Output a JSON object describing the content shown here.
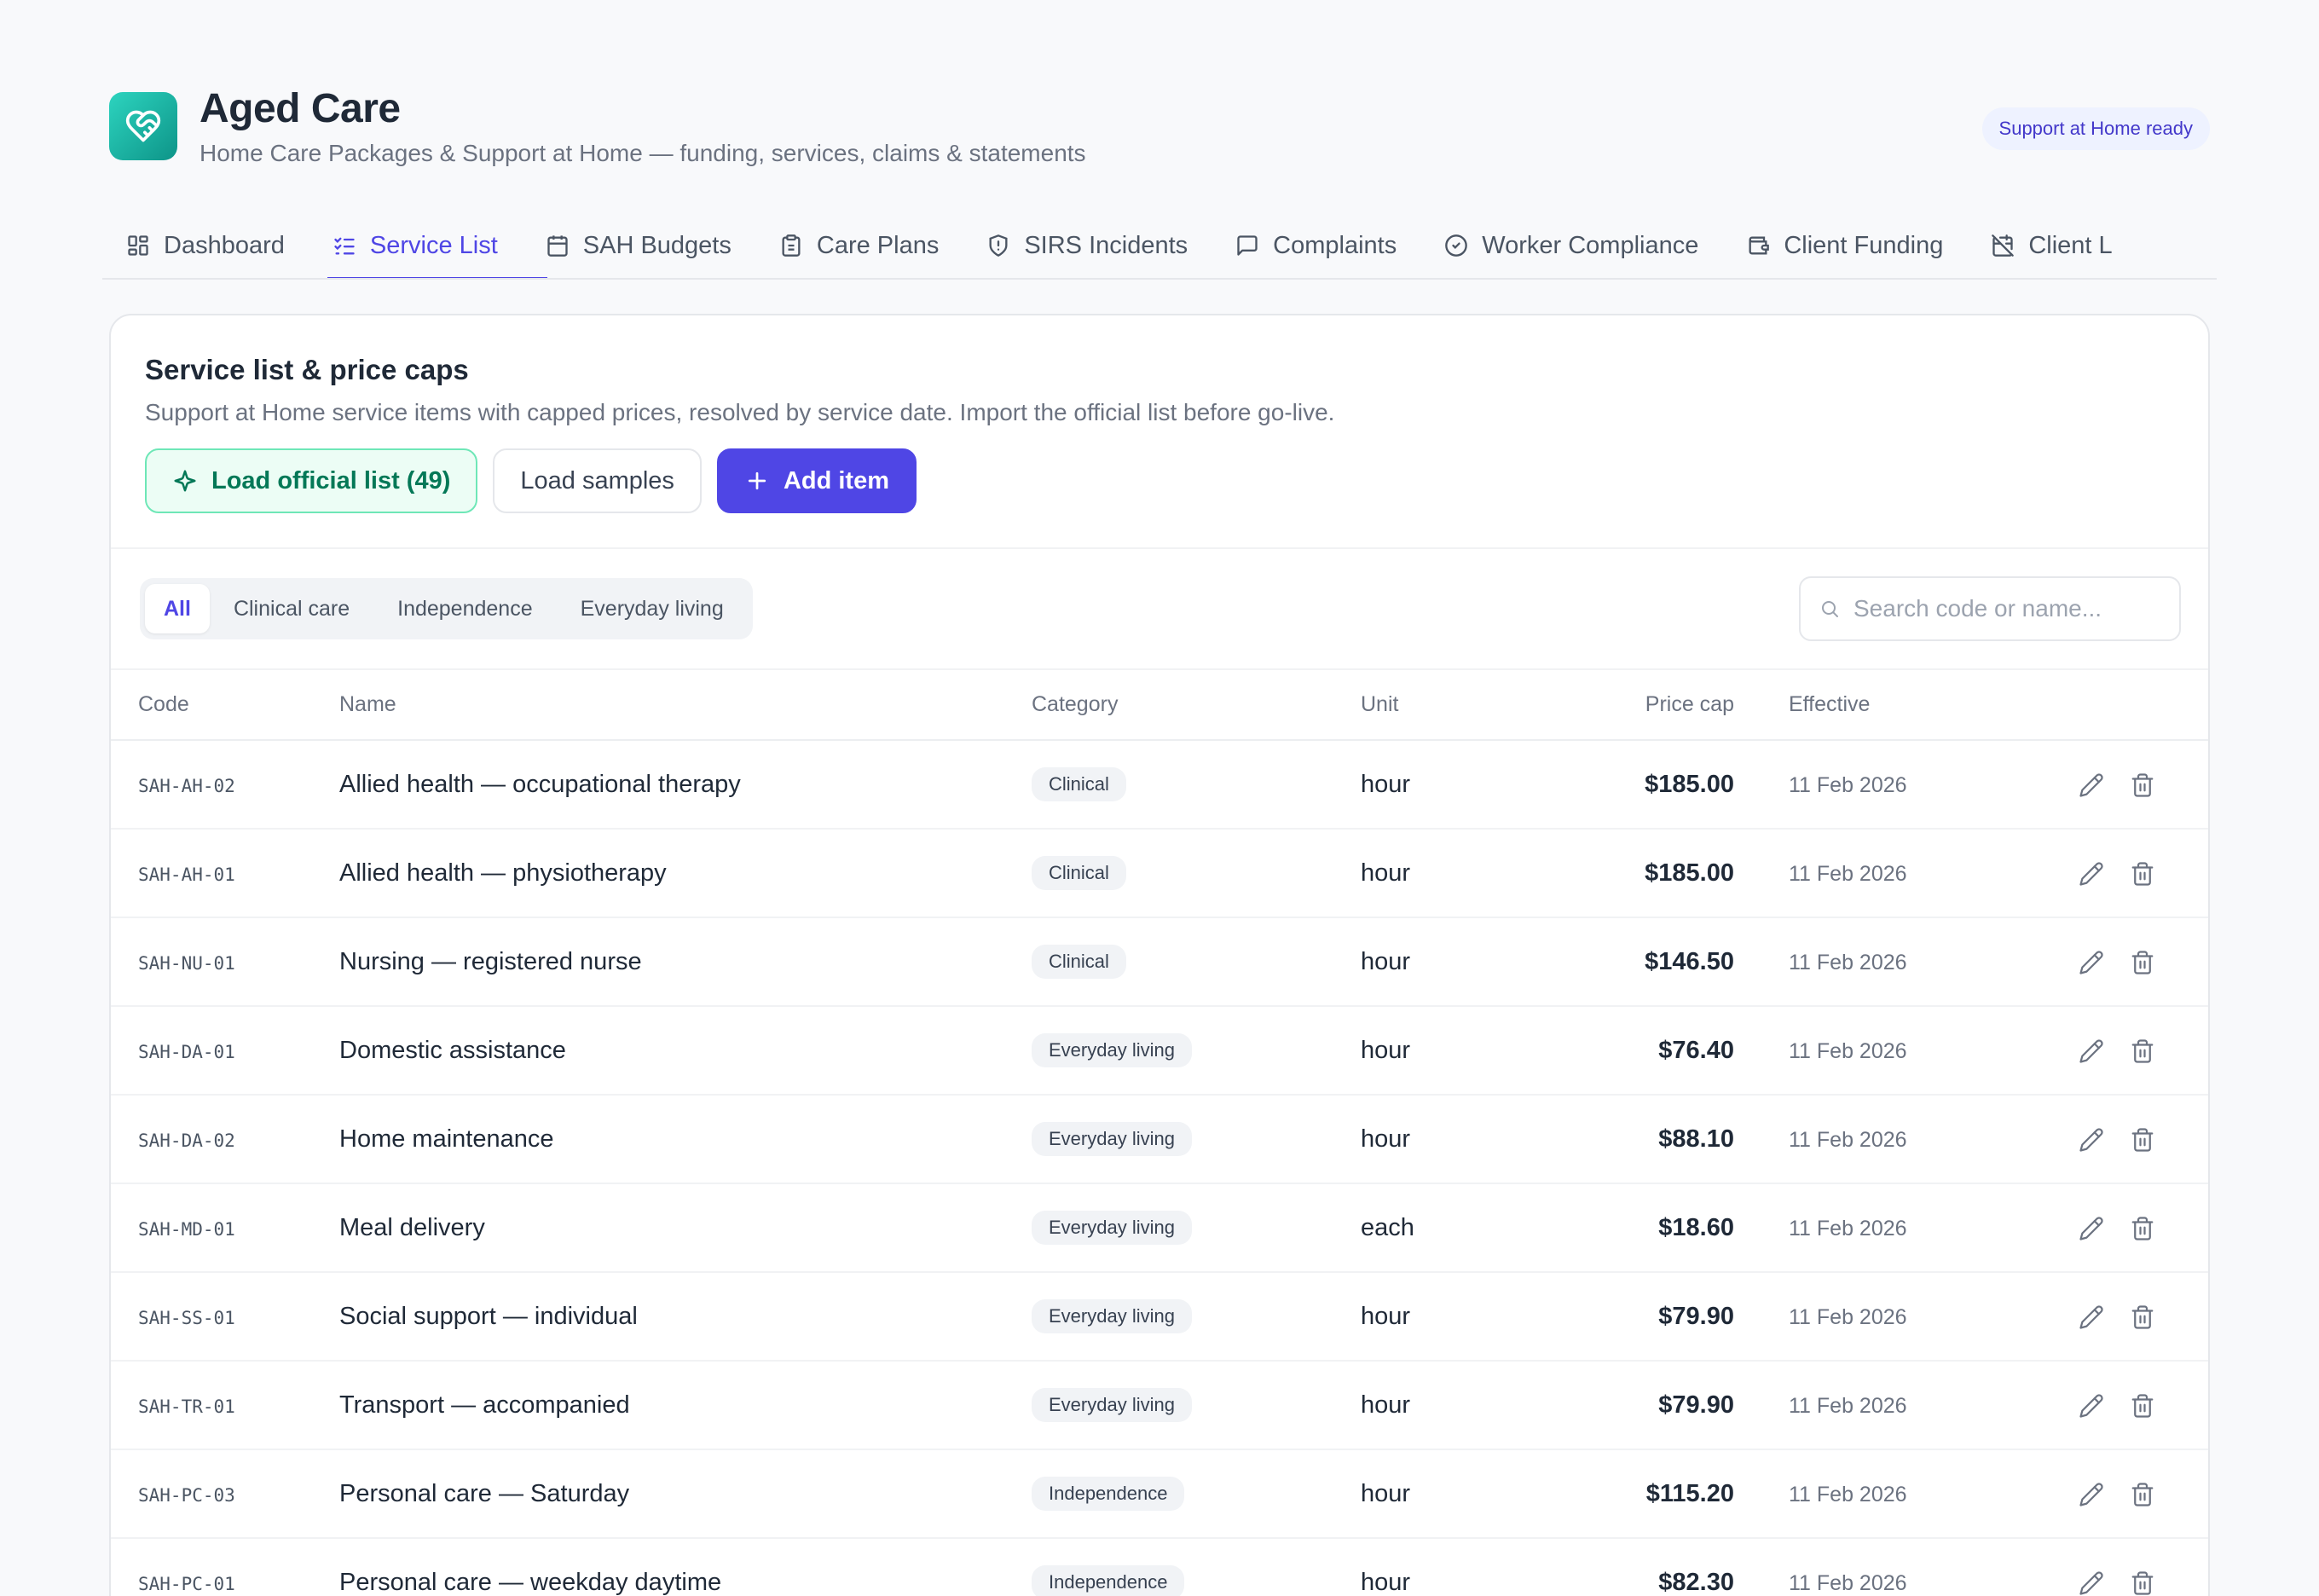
{
  "app": {
    "title": "Aged Care",
    "subtitle": "Home Care Packages & Support at Home — funding, services, claims & statements",
    "badge": "Support at Home ready",
    "logo_icon": "heart-handshake-icon",
    "accent": "#4f46e5",
    "brand": "#14b8a6"
  },
  "tabs": [
    {
      "label": "Dashboard",
      "icon": "dashboard-icon"
    },
    {
      "label": "Service List",
      "icon": "list-checks-icon",
      "active": true
    },
    {
      "label": "SAH Budgets",
      "icon": "calendar-icon"
    },
    {
      "label": "Care Plans",
      "icon": "clipboard-icon"
    },
    {
      "label": "SIRS Incidents",
      "icon": "shield-alert-icon"
    },
    {
      "label": "Complaints",
      "icon": "message-icon"
    },
    {
      "label": "Worker Compliance",
      "icon": "check-circle-icon"
    },
    {
      "label": "Client Funding",
      "icon": "wallet-icon"
    },
    {
      "label": "Client L",
      "icon": "calendar-off-icon"
    }
  ],
  "card": {
    "title": "Service list & price caps",
    "description": "Support at Home service items with capped prices, resolved by service date. Import the official list before go-live.",
    "buttons": {
      "official": "Load official list (49)",
      "samples": "Load samples",
      "add": "Add item"
    }
  },
  "filters": {
    "options": [
      "All",
      "Clinical care",
      "Independence",
      "Everyday living"
    ],
    "selected": "All"
  },
  "search": {
    "placeholder": "Search code or name..."
  },
  "table": {
    "headers": [
      "Code",
      "Name",
      "Category",
      "Unit",
      "Price cap",
      "Effective"
    ],
    "rows": [
      {
        "code": "SAH-AH-02",
        "name": "Allied health — occupational therapy",
        "category": "Clinical",
        "unit": "hour",
        "price": "$185.00",
        "effective": "11 Feb 2026"
      },
      {
        "code": "SAH-AH-01",
        "name": "Allied health — physiotherapy",
        "category": "Clinical",
        "unit": "hour",
        "price": "$185.00",
        "effective": "11 Feb 2026"
      },
      {
        "code": "SAH-NU-01",
        "name": "Nursing — registered nurse",
        "category": "Clinical",
        "unit": "hour",
        "price": "$146.50",
        "effective": "11 Feb 2026"
      },
      {
        "code": "SAH-DA-01",
        "name": "Domestic assistance",
        "category": "Everyday living",
        "unit": "hour",
        "price": "$76.40",
        "effective": "11 Feb 2026"
      },
      {
        "code": "SAH-DA-02",
        "name": "Home maintenance",
        "category": "Everyday living",
        "unit": "hour",
        "price": "$88.10",
        "effective": "11 Feb 2026"
      },
      {
        "code": "SAH-MD-01",
        "name": "Meal delivery",
        "category": "Everyday living",
        "unit": "each",
        "price": "$18.60",
        "effective": "11 Feb 2026"
      },
      {
        "code": "SAH-SS-01",
        "name": "Social support — individual",
        "category": "Everyday living",
        "unit": "hour",
        "price": "$79.90",
        "effective": "11 Feb 2026"
      },
      {
        "code": "SAH-TR-01",
        "name": "Transport — accompanied",
        "category": "Everyday living",
        "unit": "hour",
        "price": "$79.90",
        "effective": "11 Feb 2026"
      },
      {
        "code": "SAH-PC-03",
        "name": "Personal care — Saturday",
        "category": "Independence",
        "unit": "hour",
        "price": "$115.20",
        "effective": "11 Feb 2026"
      },
      {
        "code": "SAH-PC-01",
        "name": "Personal care — weekday daytime",
        "category": "Independence",
        "unit": "hour",
        "price": "$82.30",
        "effective": "11 Feb 2026"
      }
    ]
  }
}
